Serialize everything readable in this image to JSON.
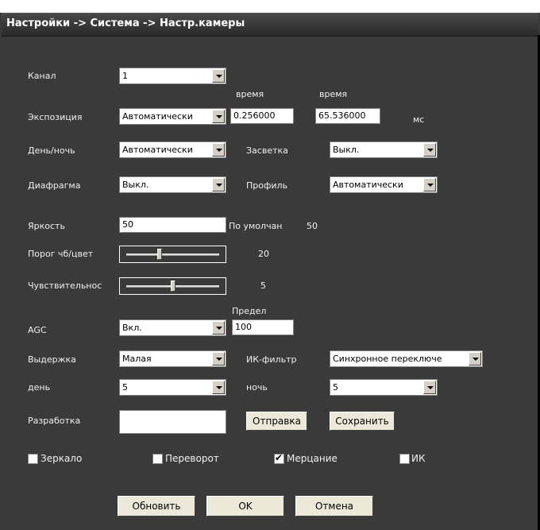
{
  "title": "Настройки -> Система -> Настр.камеры",
  "labels": {
    "channel": "Канал",
    "exposure": "Экспозиция",
    "time1": "время",
    "time2": "время",
    "ms": "мс",
    "daynight": "День/ночь",
    "backlight": "Засветка",
    "iris": "Диафрагма",
    "profile": "Профиль",
    "brightness": "Яркость",
    "default": "По умолчан",
    "default_value": "50",
    "bw_threshold": "Порог чб/цвет",
    "bw_value": "20",
    "sensitivity": "Чувствительнос",
    "sens_value": "5",
    "limit": "Предел",
    "agc": "AGC",
    "shutter": "Выдержка",
    "ir_filter": "ИК-фильтр",
    "day": "день",
    "night": "ночь",
    "dev": "Разработка"
  },
  "values": {
    "channel": "1",
    "exposure": "Автоматически",
    "time_min": "0.256000",
    "time_max": "65.536000",
    "daynight": "Автоматически",
    "backlight": "Выкл.",
    "iris": "Выкл.",
    "profile": "Автоматически",
    "brightness": "50",
    "agc": "Вкл.",
    "agc_limit": "100",
    "shutter": "Малая",
    "ir_filter": "Синхронное переключе",
    "day": "5",
    "night": "5",
    "dev": ""
  },
  "sliders": {
    "bw_threshold_fraction": 0.35,
    "sensitivity_fraction": 0.5
  },
  "buttons": {
    "send": "Отправка",
    "save": "Сохранить",
    "refresh": "Обновить",
    "ok": "OK",
    "cancel": "Отмена"
  },
  "checkboxes": [
    {
      "label": "Зеркало",
      "checked": false
    },
    {
      "label": "Переворот",
      "checked": false
    },
    {
      "label": "Мерцание",
      "checked": true
    },
    {
      "label": "ИК",
      "checked": false
    }
  ]
}
